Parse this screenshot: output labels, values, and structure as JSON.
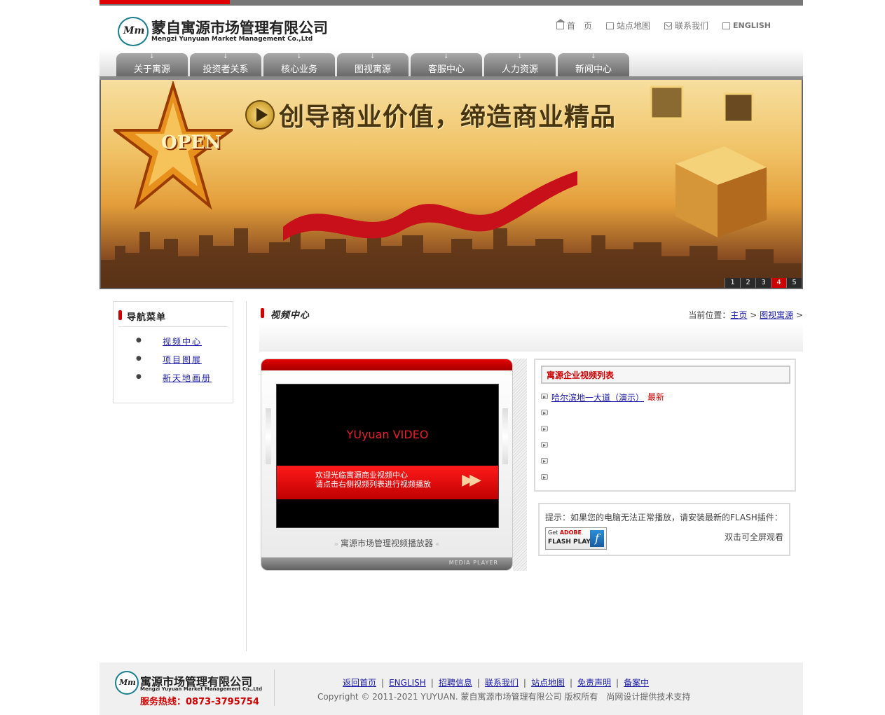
{
  "header": {
    "logo_cn": "蒙自寓源市场管理有限公司",
    "logo_en": "Mengzi Yunyuan Market Management Co.,Ltd",
    "logo_mark": "Mm",
    "links": [
      {
        "label": "首　页",
        "icon": "home-icon"
      },
      {
        "label": "站点地图",
        "icon": "sitemap-icon"
      },
      {
        "label": "联系我们",
        "icon": "mail-icon"
      },
      {
        "label": "ENGLISH",
        "icon": "document-icon"
      }
    ]
  },
  "nav": {
    "tabs": [
      "关于寓源",
      "投资者关系",
      "核心业务",
      "图视寓源",
      "客服中心",
      "人力资源",
      "新闻中心"
    ]
  },
  "banner": {
    "slogan": "创导商业价值，缔造商业精品",
    "open_text": "OPEN",
    "pages": [
      "1",
      "2",
      "3",
      "4",
      "5"
    ],
    "active_page": "4"
  },
  "sidebar": {
    "title": "导航菜单",
    "items": [
      "视频中心",
      "项目图展",
      "新天地画册"
    ]
  },
  "main": {
    "title": "视频中心",
    "breadcrumb": {
      "prefix": "当前位置：",
      "home": "主页",
      "sep": ">",
      "section": "图视寓源",
      "tail": ">"
    }
  },
  "player": {
    "logo": "YUyuan VIDEO",
    "line1": "欢迎光临寓源商业视频中心",
    "line2": "请点击右侧视频列表进行视频播放",
    "caption": "寓源市场管理视频播放器",
    "bottom_label": "MEDIA PLAYER"
  },
  "video_list": {
    "title": "寓源企业视频列表",
    "items": [
      {
        "label": "哈尔滨地一大道（演示）",
        "badge": "最新"
      },
      {
        "label": "",
        "badge": ""
      },
      {
        "label": "",
        "badge": ""
      },
      {
        "label": "",
        "badge": ""
      },
      {
        "label": "",
        "badge": ""
      },
      {
        "label": "",
        "badge": ""
      }
    ]
  },
  "flash_tip": {
    "text": "提示：如果您的电脑无法正常播放，请安装最新的FLASH插件：",
    "badge_get": "Get",
    "badge_adobe": "ADOBE",
    "badge_product": "FLASH PLAYER",
    "fullscreen": "双击可全屏观看"
  },
  "footer": {
    "logo_cn": "寓源市场管理有限公司",
    "logo_en": "Mengzi Yuyuan Market Management Co.,Ltd",
    "hotline": "服务热线：0873-3795754",
    "links": [
      "返回首页",
      "ENGLISH",
      "招聘信息",
      "联系我们",
      "站点地图",
      "免责声明",
      "备案中"
    ],
    "copyright": "Copyright © 2011-2021 YUYUAN. 蒙自寓源市场管理有限公司 版权所有　尚网设计提供技术支持"
  },
  "colors": {
    "accent_red": "#d00000",
    "link_blue": "#1a1aa6",
    "nav_grey": "#8a8a8a"
  }
}
